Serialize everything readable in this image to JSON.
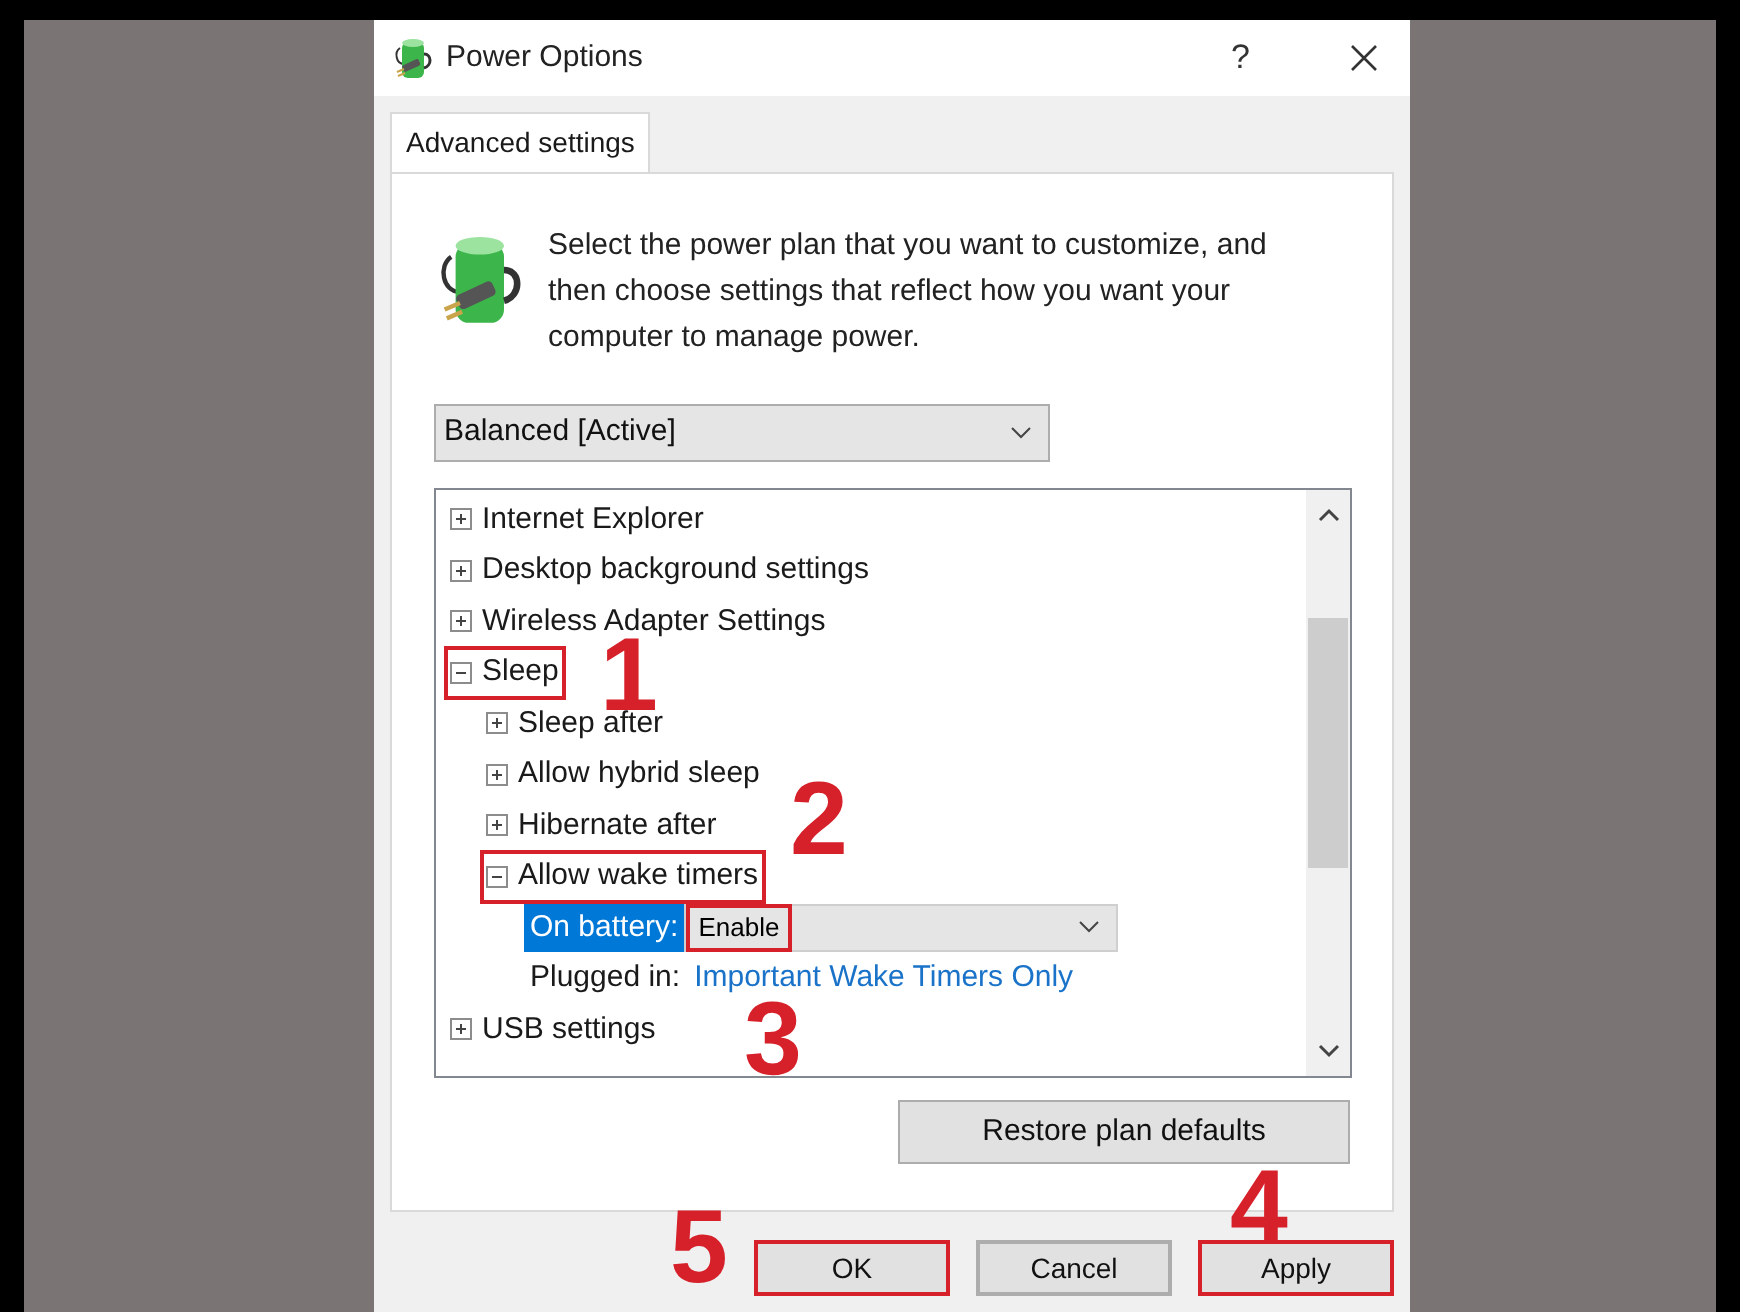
{
  "window": {
    "title": "Power Options",
    "help": "?"
  },
  "tabs": [
    {
      "label": "Advanced settings",
      "selected": true
    }
  ],
  "description": "Select the power plan that you want to customize, and then choose settings that reflect how you want your computer to manage power.",
  "plan_select": {
    "value": "Balanced [Active]"
  },
  "tree": [
    {
      "label": "Internet Explorer",
      "expanded": false,
      "highlighted": false
    },
    {
      "label": "Desktop background settings",
      "expanded": false,
      "highlighted": false
    },
    {
      "label": "Wireless Adapter Settings",
      "expanded": false,
      "highlighted": false
    },
    {
      "label": "Sleep",
      "expanded": true,
      "highlighted": true,
      "children": [
        {
          "label": "Sleep after",
          "expanded": false,
          "highlighted": false
        },
        {
          "label": "Allow hybrid sleep",
          "expanded": false,
          "highlighted": false
        },
        {
          "label": "Hibernate after",
          "expanded": false,
          "highlighted": false
        },
        {
          "label": "Allow wake timers",
          "expanded": true,
          "highlighted": true,
          "settings": [
            {
              "label": "On battery:",
              "value": "Enable",
              "kind": "dropdown",
              "selected": true,
              "highlighted": true
            },
            {
              "label": "Plugged in:",
              "value": "Important Wake Timers Only",
              "kind": "link",
              "selected": false,
              "highlighted": false
            }
          ]
        }
      ]
    },
    {
      "label": "USB settings",
      "expanded": false,
      "highlighted": false
    }
  ],
  "restore_button": "Restore plan defaults",
  "buttons": [
    {
      "label": "OK",
      "highlighted": true
    },
    {
      "label": "Cancel",
      "highlighted": false
    },
    {
      "label": "Apply",
      "highlighted": true
    }
  ],
  "annotations": [
    "1",
    "2",
    "3",
    "4",
    "5"
  ]
}
